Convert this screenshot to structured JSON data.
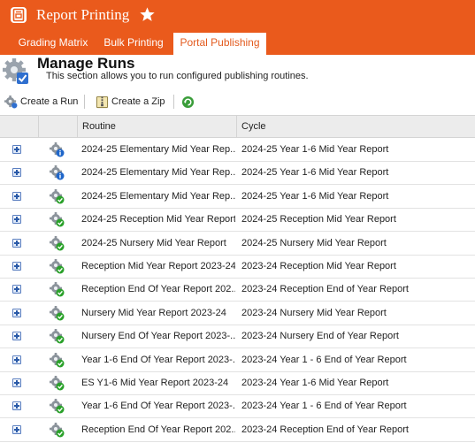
{
  "app": {
    "title": "Report Printing",
    "icon": "report-printer-icon",
    "favorite_icon": "star-icon"
  },
  "tabs": [
    {
      "label": "Grading Matrix",
      "active": false
    },
    {
      "label": "Bulk Printing",
      "active": false
    },
    {
      "label": "Portal Publishing",
      "active": true
    }
  ],
  "page": {
    "icon": "gear-check-icon",
    "title": "Manage Runs",
    "subtitle": "This section allows you to run configured publishing routines."
  },
  "toolbar": {
    "create_run": "Create a Run",
    "create_zip": "Create a Zip",
    "refresh_icon": "refresh-icon"
  },
  "grid": {
    "columns": [
      "",
      "",
      "Routine",
      "Cycle"
    ],
    "rows": [
      {
        "status": "info",
        "routine": "2024-25 Elementary Mid Year Rep...",
        "cycle": "2024-25 Year 1-6 Mid Year Report"
      },
      {
        "status": "info",
        "routine": "2024-25 Elementary Mid Year Rep...",
        "cycle": "2024-25 Year 1-6 Mid Year Report"
      },
      {
        "status": "success",
        "routine": "2024-25 Elementary Mid Year Rep...",
        "cycle": "2024-25 Year 1-6 Mid Year Report"
      },
      {
        "status": "success",
        "routine": "2024-25 Reception Mid Year Report",
        "cycle": "2024-25 Reception Mid Year Report"
      },
      {
        "status": "success",
        "routine": "2024-25 Nursery Mid Year Report",
        "cycle": "2024-25 Nursery Mid Year Report"
      },
      {
        "status": "success",
        "routine": "Reception Mid Year Report 2023-24",
        "cycle": "2023-24 Reception Mid Year Report"
      },
      {
        "status": "success",
        "routine": "Reception End Of Year Report 202...",
        "cycle": "2023-24 Reception End of Year Report"
      },
      {
        "status": "success",
        "routine": "Nursery Mid Year Report 2023-24",
        "cycle": "2023-24 Nursery Mid Year Report"
      },
      {
        "status": "success",
        "routine": "Nursery End Of Year Report 2023-...",
        "cycle": "2023-24 Nursery End of Year Report"
      },
      {
        "status": "success",
        "routine": "Year 1-6 End Of Year Report 2023-...",
        "cycle": "2023-24 Year 1 - 6 End of Year Report"
      },
      {
        "status": "success",
        "routine": "ES Y1-6 Mid Year Report 2023-24",
        "cycle": "2023-24 Year 1-6 Mid Year Report"
      },
      {
        "status": "success",
        "routine": "Year 1-6 End Of Year Report 2023-...",
        "cycle": "2023-24 Year 1 - 6 End of Year Report"
      },
      {
        "status": "success",
        "routine": "Reception End Of Year Report 202...",
        "cycle": "2023-24 Reception End of Year Report"
      }
    ]
  },
  "colors": {
    "brand": "#ea5a1c",
    "active_tab_text": "#e35b1f",
    "status_info": "#1f66c9",
    "status_success": "#2aa12a"
  }
}
